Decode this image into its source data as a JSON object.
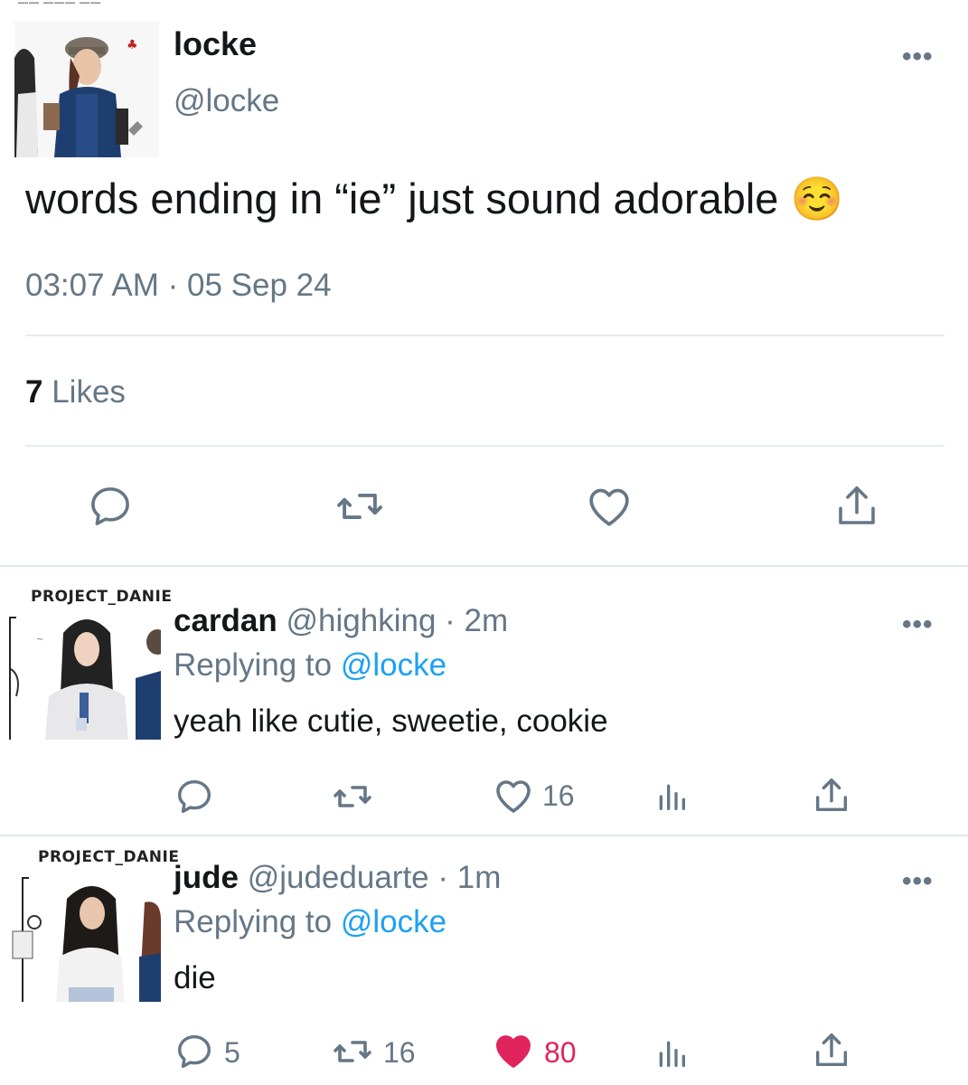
{
  "main_tweet": {
    "display_name": "locke",
    "handle": "@locke",
    "text": "words ending in “ie” just sound adorable ☺️",
    "timestamp": "03:07 AM · 05 Sep 24",
    "likes_count": "7",
    "likes_label": "Likes",
    "more_label": "•••"
  },
  "replies": [
    {
      "watermark": "PROJECT_DANIE",
      "display_name": "cardan",
      "handle_time": "@highking · 2m",
      "replying_prefix": "Replying to",
      "replying_handle": "@locke",
      "text": "yeah like cutie, sweetie, cookie",
      "reply_count": "",
      "retweet_count": "",
      "like_count": "16",
      "liked": false,
      "more_label": "•••"
    },
    {
      "watermark": "PROJECT_DANIE",
      "display_name": "jude",
      "handle_time": "@judeduarte · 1m",
      "replying_prefix": "Replying to",
      "replying_handle": "@locke",
      "text": "die",
      "reply_count": "5",
      "retweet_count": "16",
      "like_count": "80",
      "liked": true,
      "more_label": "•••"
    }
  ],
  "colors": {
    "accent": "#1da1f2",
    "muted": "#657786",
    "like": "#e0245e",
    "divider": "#e6ecf0"
  },
  "icons": [
    "reply-icon",
    "retweet-icon",
    "like-icon",
    "share-icon",
    "analytics-icon",
    "more-icon"
  ]
}
